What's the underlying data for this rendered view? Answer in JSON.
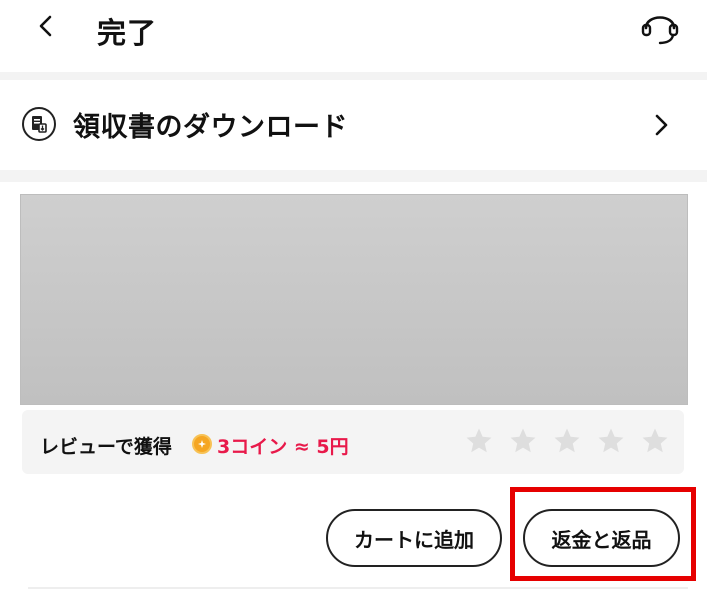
{
  "header": {
    "title": "完了",
    "back_icon": "chevron-left-icon",
    "support_icon": "headset-icon"
  },
  "receipt": {
    "label": "領収書のダウンロード",
    "icon": "receipt-icon",
    "chevron_icon": "chevron-right-icon"
  },
  "product": {
    "image_color": "#c6c6c6"
  },
  "review": {
    "prompt": "レビューで獲得",
    "reward": "3コイン ≈ 5円",
    "reward_color": "#e8194a",
    "coin_color": "#f5a623",
    "rating": 0,
    "max_rating": 5
  },
  "actions": {
    "add_to_cart_label": "カートに追加",
    "refund_label": "返金と返品"
  },
  "highlight_color": "#e60000"
}
